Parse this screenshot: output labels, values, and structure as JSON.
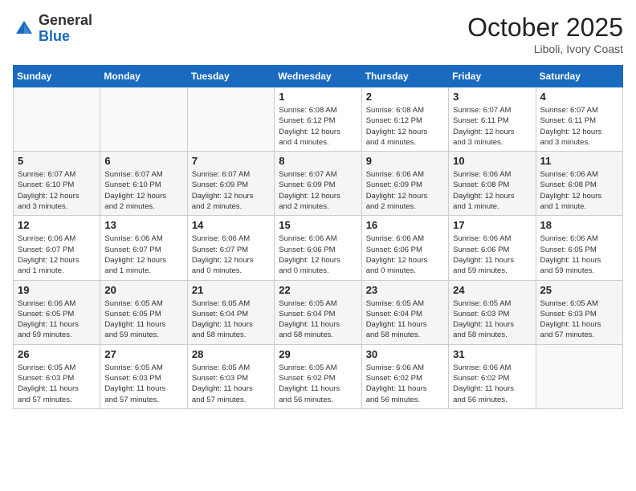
{
  "header": {
    "logo_general": "General",
    "logo_blue": "Blue",
    "month_title": "October 2025",
    "location": "Liboli, Ivory Coast"
  },
  "days_of_week": [
    "Sunday",
    "Monday",
    "Tuesday",
    "Wednesday",
    "Thursday",
    "Friday",
    "Saturday"
  ],
  "weeks": [
    [
      {
        "day": "",
        "info": ""
      },
      {
        "day": "",
        "info": ""
      },
      {
        "day": "",
        "info": ""
      },
      {
        "day": "1",
        "info": "Sunrise: 6:08 AM\nSunset: 6:12 PM\nDaylight: 12 hours\nand 4 minutes."
      },
      {
        "day": "2",
        "info": "Sunrise: 6:08 AM\nSunset: 6:12 PM\nDaylight: 12 hours\nand 4 minutes."
      },
      {
        "day": "3",
        "info": "Sunrise: 6:07 AM\nSunset: 6:11 PM\nDaylight: 12 hours\nand 3 minutes."
      },
      {
        "day": "4",
        "info": "Sunrise: 6:07 AM\nSunset: 6:11 PM\nDaylight: 12 hours\nand 3 minutes."
      }
    ],
    [
      {
        "day": "5",
        "info": "Sunrise: 6:07 AM\nSunset: 6:10 PM\nDaylight: 12 hours\nand 3 minutes."
      },
      {
        "day": "6",
        "info": "Sunrise: 6:07 AM\nSunset: 6:10 PM\nDaylight: 12 hours\nand 2 minutes."
      },
      {
        "day": "7",
        "info": "Sunrise: 6:07 AM\nSunset: 6:09 PM\nDaylight: 12 hours\nand 2 minutes."
      },
      {
        "day": "8",
        "info": "Sunrise: 6:07 AM\nSunset: 6:09 PM\nDaylight: 12 hours\nand 2 minutes."
      },
      {
        "day": "9",
        "info": "Sunrise: 6:06 AM\nSunset: 6:09 PM\nDaylight: 12 hours\nand 2 minutes."
      },
      {
        "day": "10",
        "info": "Sunrise: 6:06 AM\nSunset: 6:08 PM\nDaylight: 12 hours\nand 1 minute."
      },
      {
        "day": "11",
        "info": "Sunrise: 6:06 AM\nSunset: 6:08 PM\nDaylight: 12 hours\nand 1 minute."
      }
    ],
    [
      {
        "day": "12",
        "info": "Sunrise: 6:06 AM\nSunset: 6:07 PM\nDaylight: 12 hours\nand 1 minute."
      },
      {
        "day": "13",
        "info": "Sunrise: 6:06 AM\nSunset: 6:07 PM\nDaylight: 12 hours\nand 1 minute."
      },
      {
        "day": "14",
        "info": "Sunrise: 6:06 AM\nSunset: 6:07 PM\nDaylight: 12 hours\nand 0 minutes."
      },
      {
        "day": "15",
        "info": "Sunrise: 6:06 AM\nSunset: 6:06 PM\nDaylight: 12 hours\nand 0 minutes."
      },
      {
        "day": "16",
        "info": "Sunrise: 6:06 AM\nSunset: 6:06 PM\nDaylight: 12 hours\nand 0 minutes."
      },
      {
        "day": "17",
        "info": "Sunrise: 6:06 AM\nSunset: 6:06 PM\nDaylight: 11 hours\nand 59 minutes."
      },
      {
        "day": "18",
        "info": "Sunrise: 6:06 AM\nSunset: 6:05 PM\nDaylight: 11 hours\nand 59 minutes."
      }
    ],
    [
      {
        "day": "19",
        "info": "Sunrise: 6:06 AM\nSunset: 6:05 PM\nDaylight: 11 hours\nand 59 minutes."
      },
      {
        "day": "20",
        "info": "Sunrise: 6:05 AM\nSunset: 6:05 PM\nDaylight: 11 hours\nand 59 minutes."
      },
      {
        "day": "21",
        "info": "Sunrise: 6:05 AM\nSunset: 6:04 PM\nDaylight: 11 hours\nand 58 minutes."
      },
      {
        "day": "22",
        "info": "Sunrise: 6:05 AM\nSunset: 6:04 PM\nDaylight: 11 hours\nand 58 minutes."
      },
      {
        "day": "23",
        "info": "Sunrise: 6:05 AM\nSunset: 6:04 PM\nDaylight: 11 hours\nand 58 minutes."
      },
      {
        "day": "24",
        "info": "Sunrise: 6:05 AM\nSunset: 6:03 PM\nDaylight: 11 hours\nand 58 minutes."
      },
      {
        "day": "25",
        "info": "Sunrise: 6:05 AM\nSunset: 6:03 PM\nDaylight: 11 hours\nand 57 minutes."
      }
    ],
    [
      {
        "day": "26",
        "info": "Sunrise: 6:05 AM\nSunset: 6:03 PM\nDaylight: 11 hours\nand 57 minutes."
      },
      {
        "day": "27",
        "info": "Sunrise: 6:05 AM\nSunset: 6:03 PM\nDaylight: 11 hours\nand 57 minutes."
      },
      {
        "day": "28",
        "info": "Sunrise: 6:05 AM\nSunset: 6:03 PM\nDaylight: 11 hours\nand 57 minutes."
      },
      {
        "day": "29",
        "info": "Sunrise: 6:05 AM\nSunset: 6:02 PM\nDaylight: 11 hours\nand 56 minutes."
      },
      {
        "day": "30",
        "info": "Sunrise: 6:06 AM\nSunset: 6:02 PM\nDaylight: 11 hours\nand 56 minutes."
      },
      {
        "day": "31",
        "info": "Sunrise: 6:06 AM\nSunset: 6:02 PM\nDaylight: 11 hours\nand 56 minutes."
      },
      {
        "day": "",
        "info": ""
      }
    ]
  ]
}
